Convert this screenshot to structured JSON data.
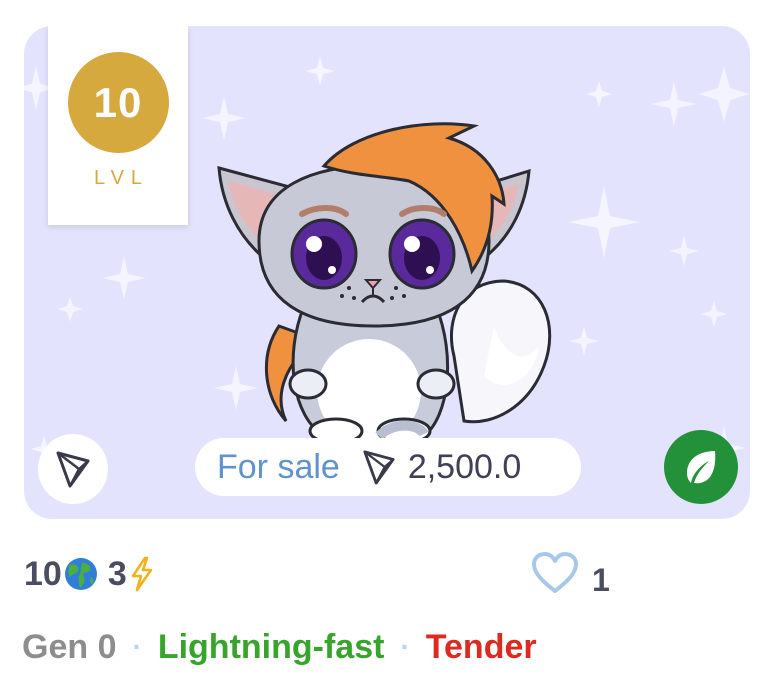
{
  "card": {
    "background_color": "#e3e3fd",
    "level": {
      "value": "10",
      "label": "LVL",
      "color": "#d6a93f"
    },
    "sale": {
      "label": "For sale",
      "price": "2,500.0"
    },
    "accent_colors": {
      "sale_label": "#5f92cf",
      "leaf_button": "#22913a"
    },
    "icons": {
      "chain": "tron-icon",
      "action": "leaf-icon"
    }
  },
  "stats": {
    "globe_count": "10",
    "globe_icon": "globe-emoji-icon",
    "energy_count": "3",
    "energy_icon": "lightning-icon"
  },
  "likes": {
    "count": "1",
    "icon": "heart-outline-icon"
  },
  "traits": {
    "generation": "Gen 0",
    "separator": "·",
    "speed": "Lightning-fast",
    "personality": "Tender",
    "colors": {
      "generation": "#8d8d8d",
      "speed": "#37a52b",
      "personality": "#dd2a20"
    }
  }
}
